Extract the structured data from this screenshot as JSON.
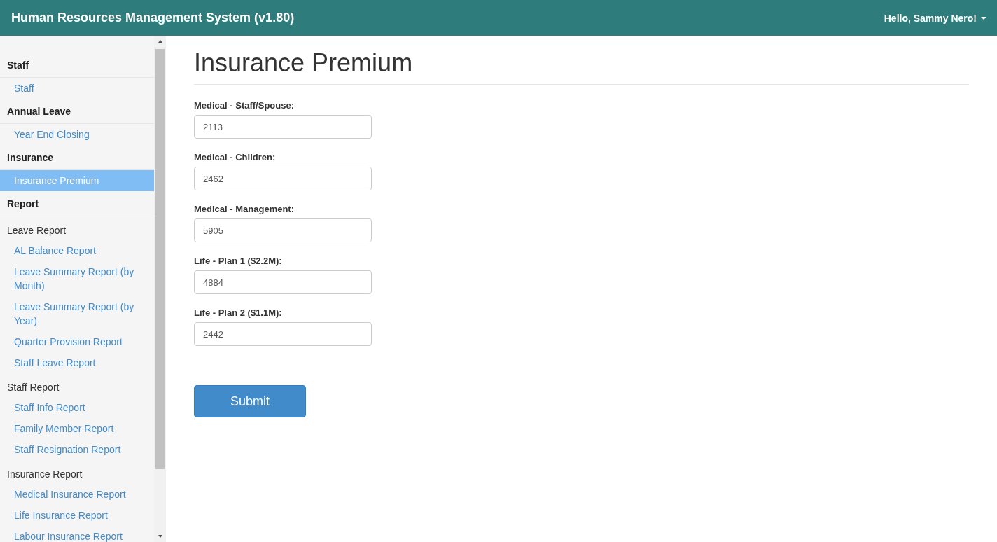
{
  "navbar": {
    "title": "Human Resources Management System (v1.80)",
    "user_menu": "Hello, Sammy Nero!"
  },
  "sidebar": {
    "items": [
      {
        "kind": "section",
        "label": "Staff"
      },
      {
        "kind": "link",
        "label": "Staff",
        "selected": false
      },
      {
        "kind": "section",
        "label": "Annual Leave"
      },
      {
        "kind": "link",
        "label": "Year End Closing",
        "selected": false
      },
      {
        "kind": "section",
        "label": "Insurance"
      },
      {
        "kind": "link",
        "label": "Insurance Premium",
        "selected": true
      },
      {
        "kind": "section",
        "label": "Report"
      },
      {
        "kind": "group",
        "label": "Leave Report"
      },
      {
        "kind": "link",
        "label": "AL Balance Report",
        "selected": false
      },
      {
        "kind": "link",
        "label": "Leave Summary Report (by Month)",
        "selected": false
      },
      {
        "kind": "link",
        "label": "Leave Summary Report (by Year)",
        "selected": false
      },
      {
        "kind": "link",
        "label": "Quarter Provision Report",
        "selected": false
      },
      {
        "kind": "link",
        "label": "Staff Leave Report",
        "selected": false
      },
      {
        "kind": "group",
        "label": "Staff Report"
      },
      {
        "kind": "link",
        "label": "Staff Info Report",
        "selected": false
      },
      {
        "kind": "link",
        "label": "Family Member Report",
        "selected": false
      },
      {
        "kind": "link",
        "label": "Staff Resignation Report",
        "selected": false
      },
      {
        "kind": "group",
        "label": "Insurance Report"
      },
      {
        "kind": "link",
        "label": "Medical Insurance Report",
        "selected": false
      },
      {
        "kind": "link",
        "label": "Life Insurance Report",
        "selected": false
      },
      {
        "kind": "link",
        "label": "Labour Insurance Report",
        "selected": false
      }
    ]
  },
  "page": {
    "heading": "Insurance Premium",
    "fields": [
      {
        "label": "Medical - Staff/Spouse:",
        "value": "2113"
      },
      {
        "label": "Medical - Children:",
        "value": "2462"
      },
      {
        "label": "Medical - Management:",
        "value": "5905"
      },
      {
        "label": "Life - Plan 1 ($2.2M):",
        "value": "4884"
      },
      {
        "label": "Life - Plan 2 ($1.1M):",
        "value": "2442"
      }
    ],
    "submit": "Submit"
  }
}
